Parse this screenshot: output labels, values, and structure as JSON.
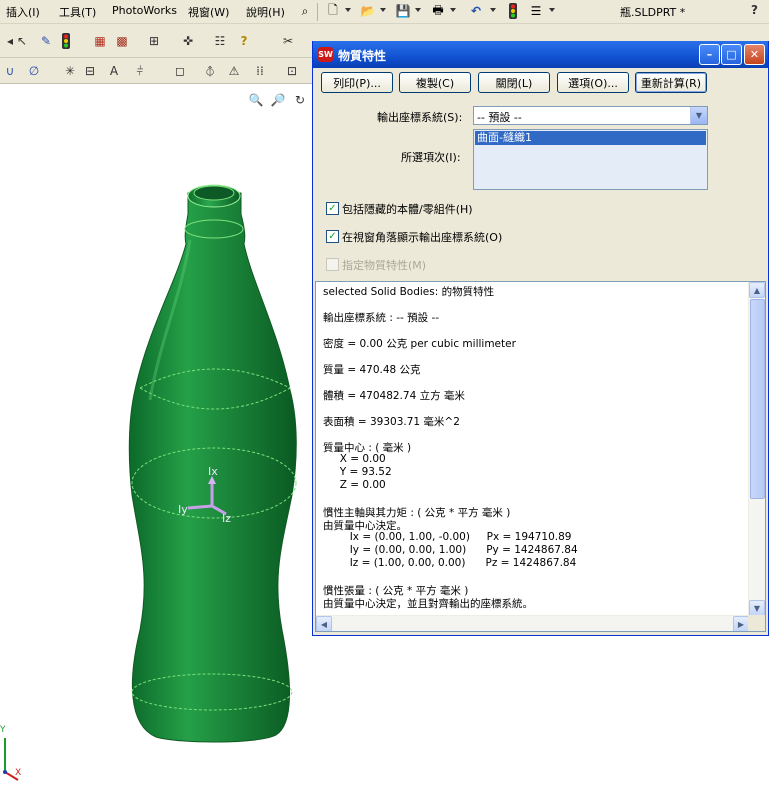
{
  "menubar": {
    "items": [
      "插入(I)",
      "工具(T)",
      "PhotoWorks",
      "視窗(W)",
      "說明(H)"
    ],
    "doc_title": "瓶.SLDPRT *",
    "help": "?"
  },
  "dialog": {
    "title": "物質特性",
    "logo": "SW",
    "buttons": {
      "print": "列印(P)...",
      "copy": "複製(C)",
      "close": "關閉(L)",
      "options": "選項(O)...",
      "recalc": "重新計算(R)"
    },
    "coord_label": "輸出座標系統(S):",
    "coord_value": "-- 預設 --",
    "selected_label": "所選項次(I):",
    "selected_items": [
      "曲面-縫織1"
    ],
    "checkboxes": {
      "include_hidden": {
        "label": "包括隱藏的本體/零組件(H)",
        "checked": true
      },
      "show_coord": {
        "label": "在視窗角落顯示輸出座標系統(O)",
        "checked": true
      },
      "assigned_props": {
        "label": "指定物質特性(M)",
        "checked": false,
        "disabled": true
      }
    },
    "results": [
      "selected Solid Bodies: 的物質特性",
      "",
      "輸出座標系統 : -- 預設 --",
      "",
      "密度 = 0.00 公克 per cubic millimeter",
      "",
      "質量 = 470.48 公克",
      "",
      "體積 = 470482.74 立方 毫米",
      "",
      "表面積 = 39303.71 毫米^2",
      "",
      "質量中心 : ( 毫米 )",
      "     X = 0.00",
      "     Y = 93.52",
      "     Z = 0.00",
      "",
      "慣性主軸與其力矩 : ( 公克 * 平方 毫米 )",
      "由質量中心決定。",
      "        Ix = (0.00, 1.00, -0.00)     Px = 194710.89",
      "        Iy = (0.00, 0.00, 1.00)      Py = 1424867.84",
      "        Iz = (1.00, 0.00, 0.00)      Pz = 1424867.84",
      "",
      "慣性張量 : ( 公克 * 平方 毫米 )",
      "由質量中心決定，並且對齊輸出的座標系統。"
    ]
  },
  "viewport": {
    "triad": {
      "x": "Ix",
      "y": "Iy",
      "z": "Iz"
    },
    "corner": {
      "y": "Y",
      "x": "X"
    }
  },
  "colors": {
    "bottle": "#1f8a3a",
    "dialog_title": "#1c5fdc",
    "dialog_bg": "#ece9d8",
    "selection": "#316ac5"
  }
}
